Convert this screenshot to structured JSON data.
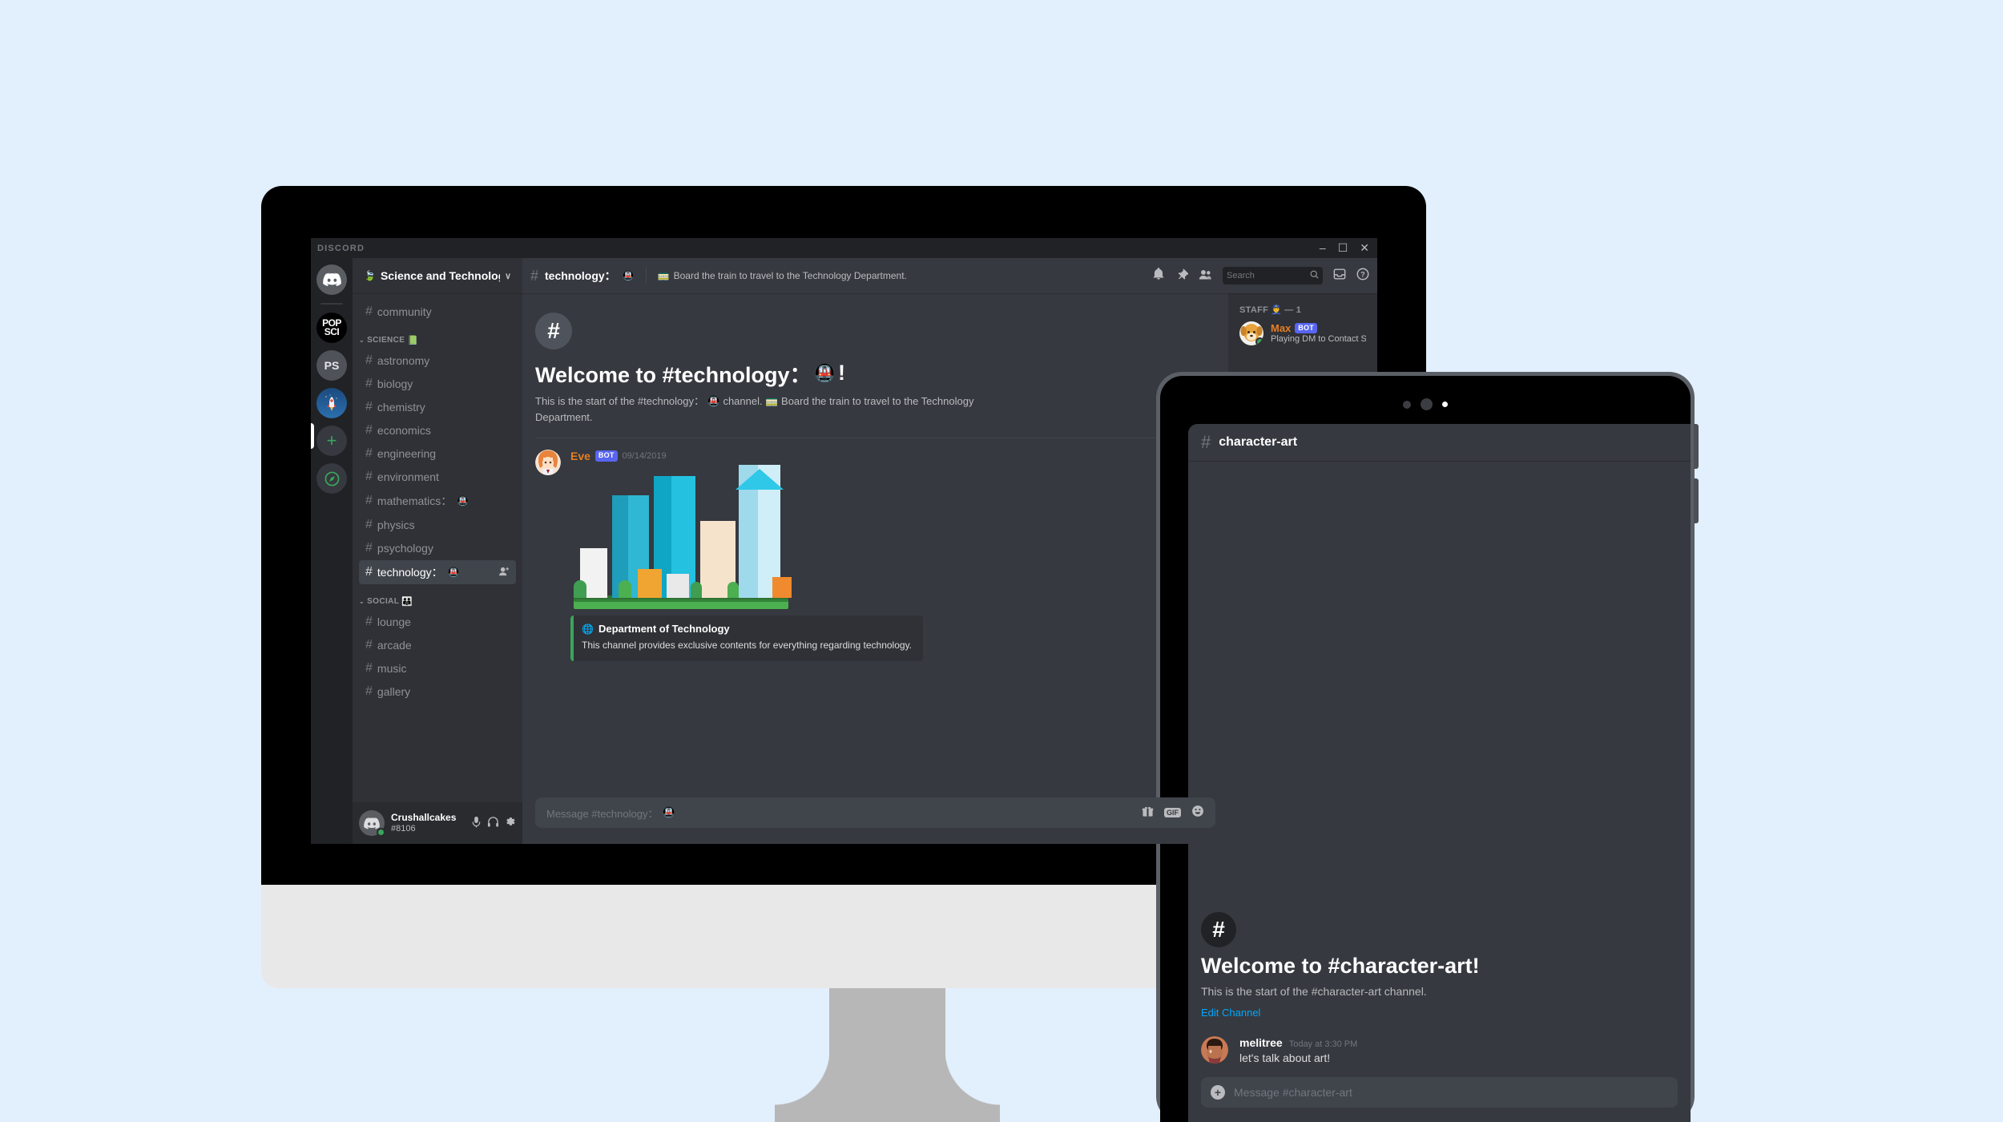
{
  "theme": {
    "page_background": "#e2effc",
    "discord_dark": "#36393f",
    "discord_darker": "#2f3136",
    "discord_darkest": "#202225",
    "brand_blurple": "#5865f2",
    "accent_green": "#3ba55c",
    "link_blue": "#00a8fc",
    "monitor_chin": "#e8e8e8",
    "monitor_stand": "#b7b7b7"
  },
  "desktop": {
    "titlebar": {
      "brand": "DISCORD",
      "minimize": "–",
      "maximize": "☐",
      "close": "✕"
    },
    "server_rail": [
      {
        "name": "home",
        "label": "",
        "type": "home"
      },
      {
        "name": "pop-sci",
        "label": "POP\nSCI",
        "type": "popsci"
      },
      {
        "name": "ps",
        "label": "PS",
        "type": "ps"
      },
      {
        "name": "rocket-server",
        "label": "🚀",
        "type": "rocket",
        "active": true
      },
      {
        "name": "add-server",
        "label": "+",
        "type": "addsrv"
      },
      {
        "name": "explore-servers",
        "label": "🧭",
        "type": "explore"
      }
    ],
    "guild": {
      "name": "Science and Technology",
      "badge_icon": "🍃",
      "chevron": "∨"
    },
    "channel_groups": [
      {
        "header": null,
        "channels": [
          {
            "name": "community",
            "emoji": "",
            "active": false
          }
        ]
      },
      {
        "header": "SCIENCE",
        "header_emoji": "📗",
        "caret": "⌄",
        "channels": [
          {
            "name": "astronomy",
            "emoji": "",
            "active": false
          },
          {
            "name": "biology",
            "emoji": "",
            "active": false
          },
          {
            "name": "chemistry",
            "emoji": "",
            "active": false
          },
          {
            "name": "economics",
            "emoji": "",
            "active": false
          },
          {
            "name": "engineering",
            "emoji": "",
            "active": false
          },
          {
            "name": "environment",
            "emoji": "",
            "active": false
          },
          {
            "name": "mathematics：",
            "emoji": "🚇",
            "active": false
          },
          {
            "name": "physics",
            "emoji": "",
            "active": false
          },
          {
            "name": "psychology",
            "emoji": "",
            "active": false
          },
          {
            "name": "technology：",
            "emoji": "🚇",
            "active": true,
            "add_member_icon": "👤⁺"
          }
        ]
      },
      {
        "header": "SOCIAL",
        "header_emoji": "👪",
        "caret": "⌄",
        "channels": [
          {
            "name": "lounge",
            "emoji": "",
            "active": false
          },
          {
            "name": "arcade",
            "emoji": "",
            "active": false
          },
          {
            "name": "music",
            "emoji": "",
            "active": false
          },
          {
            "name": "gallery",
            "emoji": "",
            "active": false
          }
        ]
      }
    ],
    "user_panel": {
      "username": "Crushallcakes",
      "discriminator": "#8106",
      "status": "online",
      "mute_icon": "🎤",
      "deafen_icon": "🎧",
      "settings_icon": "⚙"
    },
    "channel_header": {
      "hash": "#",
      "channel_name": "technology：",
      "channel_emoji": "🚇",
      "topic_emoji": "🚃",
      "topic": "Board the train to travel to the Technology Department.",
      "icons": {
        "bell": "🔔",
        "pin": "📌",
        "members": "👥",
        "inbox": "📥",
        "help": "?"
      },
      "search_placeholder": "Search",
      "search_icon": "🔍"
    },
    "welcome": {
      "hash": "#",
      "title_prefix": "Welcome to #technology：",
      "title_emoji": "🚇",
      "title_suffix": "!",
      "body_before": "This is the start of the #technology：",
      "body_emoji_1": "🚇",
      "body_mid": "channel.",
      "body_emoji_2": "🚃",
      "body_after": "Board the train to travel to the Technology Department."
    },
    "message": {
      "author": "Eve",
      "author_color": "#e67e22",
      "bot_tag": "BOT",
      "timestamp": "09/14/2019",
      "embed": {
        "icon": "🌐",
        "title": "Department of Technology",
        "description": "This channel provides exclusive contents for everything regarding technology."
      }
    },
    "message_box": {
      "placeholder": "Message #technology：",
      "placeholder_emoji": "🚇",
      "gift_icon": "🎁",
      "gif_label": "GIF",
      "emoji_icon": "😃"
    },
    "member_list": {
      "category": "STAFF",
      "category_emoji": "👮",
      "category_count": "— 1",
      "members": [
        {
          "name": "Max",
          "name_color": "#e67e22",
          "bot_tag": "BOT",
          "activity": "Playing DM to Contact Staffs",
          "status": "online"
        }
      ]
    }
  },
  "tablet": {
    "header": {
      "hash": "#",
      "channel_name": "character-art"
    },
    "welcome": {
      "hash": "#",
      "title": "Welcome to #character-art!",
      "subtitle": "This is the start of the #character-art channel.",
      "edit_link": "Edit Channel"
    },
    "message": {
      "author": "melitree",
      "timestamp": "Today at 3:30 PM",
      "text": "let's talk about art!"
    },
    "input": {
      "plus_icon": "+",
      "placeholder": "Message #character-art"
    }
  }
}
